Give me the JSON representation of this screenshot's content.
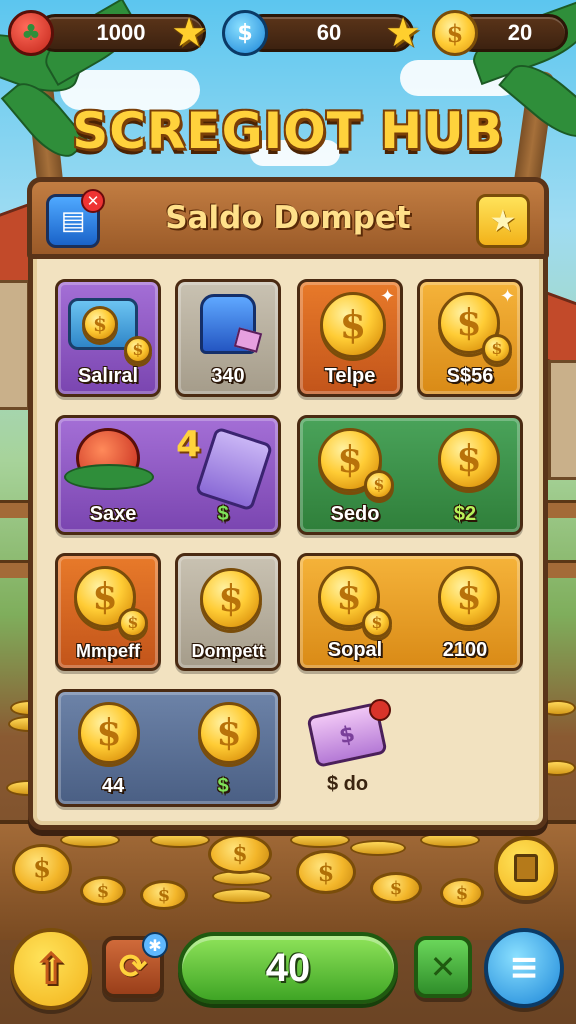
{
  "topbar": {
    "hearts_value": "1000",
    "gems_value": "60",
    "coins_value": "20"
  },
  "title": "SCREGIOT HUB",
  "panel": {
    "title": "Saldo Dompet"
  },
  "tiles": [
    {
      "label": "Salıral"
    },
    {
      "label": "340"
    },
    {
      "label": "Telpe"
    },
    {
      "label": "S$56"
    },
    {
      "label": "Saxe"
    },
    {
      "label": "4"
    },
    {
      "label": "$"
    },
    {
      "label": "Sedo"
    },
    {
      "label": "$2"
    },
    {
      "label": "Mmpeff"
    },
    {
      "label": "Dompett"
    },
    {
      "label": "Sopal"
    },
    {
      "label": "2100"
    },
    {
      "label": "44"
    },
    {
      "label": "$"
    },
    {
      "label": "$ do"
    }
  ],
  "bottombar": {
    "main_value": "40"
  },
  "colors": {
    "accent": "#ffd23c",
    "panel": "#f2e2c0",
    "wood": "#5a3419",
    "green": "#3fa525"
  },
  "icons": [
    "strawberry-icon",
    "star-icon",
    "gem-drop-icon",
    "coin-icon",
    "card-icon",
    "gift-icon",
    "trash-icon",
    "upload-arrow-icon",
    "refresh-icon",
    "shuffle-icon",
    "menu-icon"
  ]
}
